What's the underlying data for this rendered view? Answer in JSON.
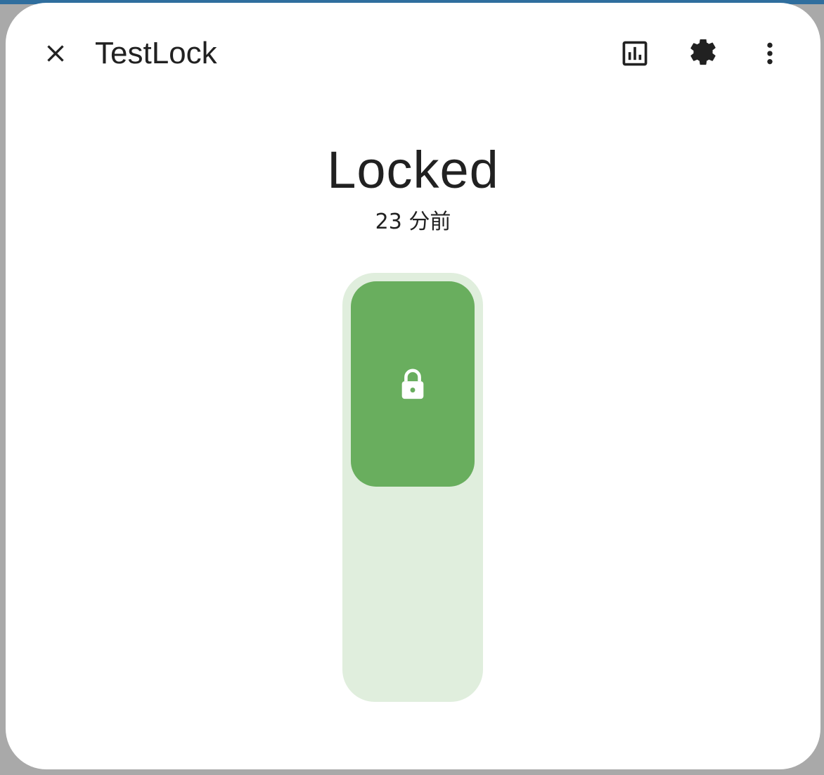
{
  "dialog": {
    "title": "TestLock",
    "state": "Locked",
    "last_changed": "23 分前"
  },
  "icons": {
    "close": "close-icon",
    "history": "chart-box-icon",
    "settings": "cog-icon",
    "more": "dots-vertical-icon",
    "lock": "lock-icon"
  },
  "toggle": {
    "state": "locked",
    "level": 1
  },
  "colors": {
    "accent": "#69ae5e",
    "track": "#e0eedd",
    "backdrop_top": "#2f6e9e"
  }
}
